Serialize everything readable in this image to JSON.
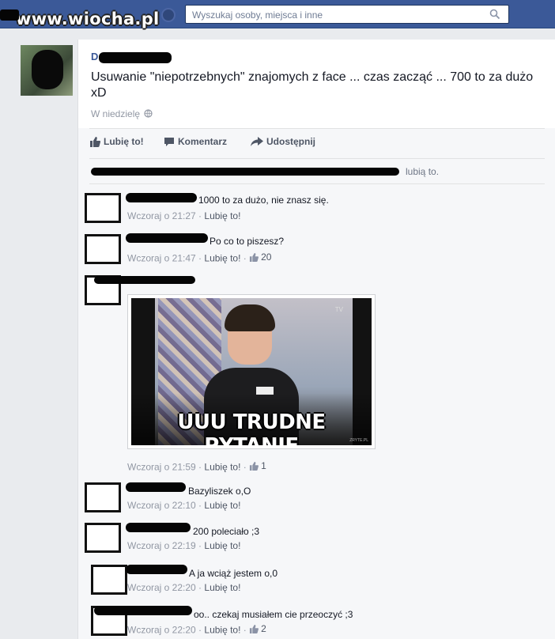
{
  "header": {
    "watermark": "www.wiocha.pl",
    "search_placeholder": "Wyszukaj osoby, miejsca i inne"
  },
  "post": {
    "author_initial": "D",
    "text": "Usuwanie \"niepotrzebnych\" znajomych z face ... czas zacząć ... 700 to za dużo xD",
    "timestamp": "W niedzielę"
  },
  "actions": {
    "like": "Lubię to!",
    "comment": "Komentarz",
    "share": "Udostępnij"
  },
  "likes_summary": "lubią to.",
  "comments": [
    {
      "text": "1000 to za dużo, nie znasz się.",
      "time": "Wczoraj o 21:27",
      "like": "Lubię to!",
      "count": ""
    },
    {
      "text": "Po co to piszesz?",
      "time": "Wczoraj o 21:47",
      "like": "Lubię to!",
      "count": "20"
    },
    {
      "text": "",
      "time": "Wczoraj o 21:59",
      "like": "Lubię to!",
      "count": "1",
      "image_caption": "UUU TRUDNE PYTANIE",
      "image_logo": "TV",
      "image_credit": "ZRYTE.PL"
    },
    {
      "text": "Bazyliszek o,O",
      "time": "Wczoraj o 22:10",
      "like": "Lubię to!",
      "count": ""
    },
    {
      "text": "200 poleciało ;3",
      "time": "Wczoraj o 22:19",
      "like": "Lubię to!",
      "count": ""
    },
    {
      "text": "A ja wciąż jestem o,0",
      "time": "Wczoraj o 22:20",
      "like": "Lubię to!",
      "count": ""
    },
    {
      "text": "oo.. czekaj musiałem cie przeoczyć ;3",
      "time": "Wczoraj o 22:20",
      "like": "Lubię to!",
      "count": "2"
    }
  ],
  "colors": {
    "brand_blue": "#3b5998",
    "meta_grey": "#9197a3",
    "background": "#e9ebee"
  },
  "icons": {
    "search": "magnifier-icon",
    "globe": "globe-icon",
    "like": "thumbs-up-icon",
    "comment": "speech-bubble-icon",
    "share": "share-arrow-icon"
  }
}
